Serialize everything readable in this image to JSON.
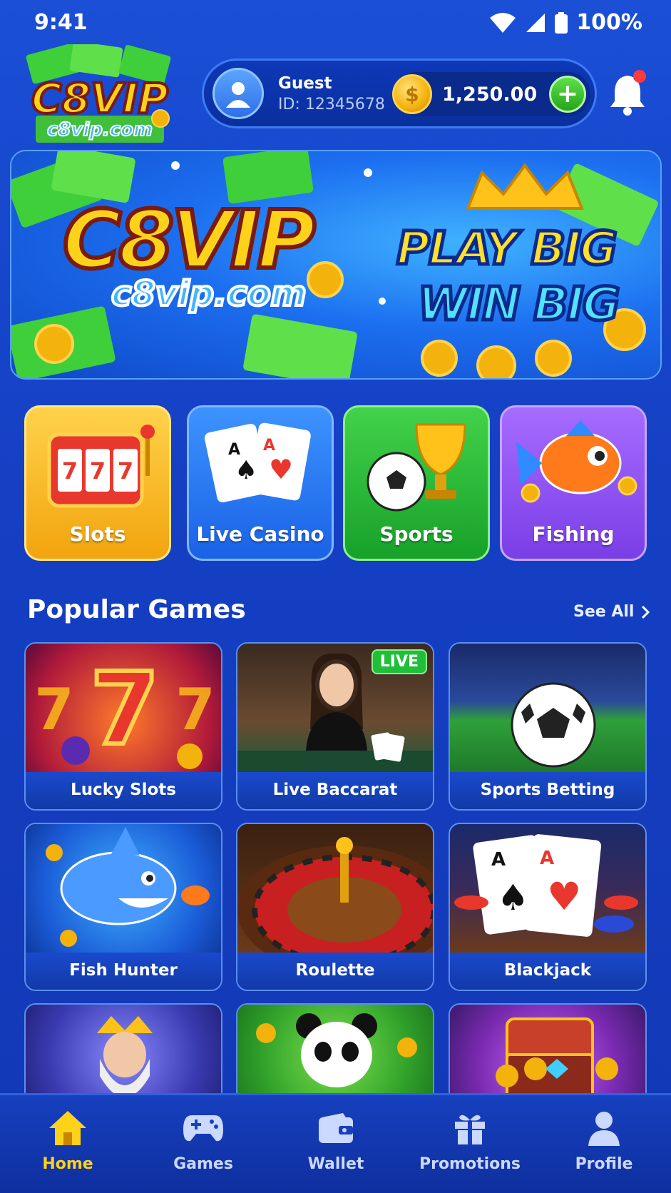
{
  "status_bar": {
    "time": "9:41",
    "battery": "100%"
  },
  "header": {
    "logo_text": "C8VIP",
    "logo_domain": "c8vip.com",
    "user_name": "Guest",
    "user_id": "ID: 12345678",
    "balance": "1,250.00",
    "add_label": "+",
    "coin_symbol": "$"
  },
  "banner": {
    "brand": "C8VIP",
    "domain": "c8vip.com",
    "tagline_line1": "PLAY BIG",
    "tagline_line2": "WIN BIG"
  },
  "categories": [
    {
      "label": "Slots",
      "color": "#f7b719"
    },
    {
      "label": "Live Casino",
      "color": "#2a7af5"
    },
    {
      "label": "Sports",
      "color": "#22b836"
    },
    {
      "label": "Fishing",
      "color": "#8c4ff0"
    }
  ],
  "popular": {
    "title": "Popular Games",
    "see_all": "See All",
    "games": [
      {
        "label": "Lucky Slots"
      },
      {
        "label": "Live Baccarat",
        "badge": "LIVE"
      },
      {
        "label": "Sports Betting"
      },
      {
        "label": "Fish Hunter"
      },
      {
        "label": "Roulette"
      },
      {
        "label": "Blackjack"
      }
    ]
  },
  "bottom_nav": [
    {
      "label": "Home",
      "icon": "home-icon",
      "active": true
    },
    {
      "label": "Games",
      "icon": "gamepad-icon"
    },
    {
      "label": "Wallet",
      "icon": "wallet-icon"
    },
    {
      "label": "Promotions",
      "icon": "gift-icon"
    },
    {
      "label": "Profile",
      "icon": "profile-icon"
    }
  ],
  "colors": {
    "accent": "#ffd21a",
    "background": "#1540c4",
    "live": "#1fbf3a"
  }
}
